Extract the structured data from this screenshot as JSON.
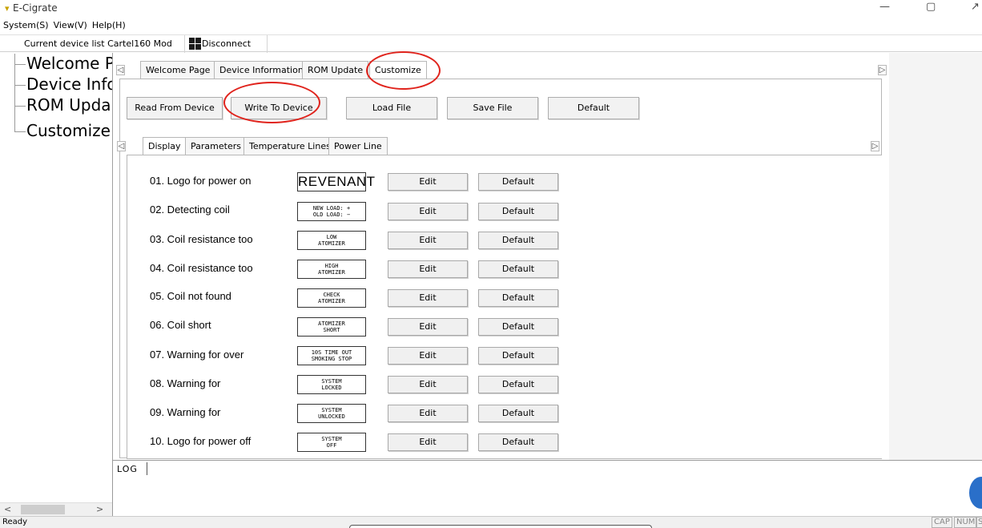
{
  "window": {
    "title": "E-Cigrate",
    "icon": "app-icon",
    "minimize": "—",
    "maximize": "▢",
    "restore": "↗"
  },
  "menu": {
    "items": [
      "System(S)",
      "View(V)",
      "Help(H)"
    ]
  },
  "device_bar": {
    "label": "Current device list",
    "device": "Cartel160 Mod",
    "disconnect_label": "Disconnect"
  },
  "tree": {
    "items": [
      "Welcome P",
      "Device Info",
      "ROM Upda",
      "Customize"
    ]
  },
  "top_tabs": [
    "Welcome Page",
    "Device Information",
    "ROM Update",
    "Customize"
  ],
  "actions": {
    "read": "Read From Device",
    "write": "Write To Device",
    "load": "Load File",
    "save": "Save File",
    "default": "Default"
  },
  "sub_tabs": [
    "Display",
    "Parameters",
    "Temperature Lines",
    "Power Line"
  ],
  "rows": [
    {
      "label": "01. Logo for power on",
      "preview": "REVENANT",
      "edit": "Edit",
      "default": "Default"
    },
    {
      "label": "02. Detecting coil",
      "preview": "NEW LOAD: +\nOLD LOAD: −",
      "edit": "Edit",
      "default": "Default"
    },
    {
      "label": "03. Coil resistance too",
      "preview": "LOW\nATOMIZER",
      "edit": "Edit",
      "default": "Default"
    },
    {
      "label": "04. Coil resistance too",
      "preview": "HIGH\nATOMIZER",
      "edit": "Edit",
      "default": "Default"
    },
    {
      "label": "05. Coil not found",
      "preview": "CHECK\nATOMIZER",
      "edit": "Edit",
      "default": "Default"
    },
    {
      "label": "06. Coil short",
      "preview": "ATOMIZER\nSHORT",
      "edit": "Edit",
      "default": "Default"
    },
    {
      "label": "07. Warning for over",
      "preview": "10S TIME OUT\nSMOKING STOP",
      "edit": "Edit",
      "default": "Default"
    },
    {
      "label": "08. Warning for",
      "preview": "SYSTEM\nLOCKED",
      "edit": "Edit",
      "default": "Default"
    },
    {
      "label": "09. Warning for",
      "preview": "SYSTEM\nUNLOCKED",
      "edit": "Edit",
      "default": "Default"
    },
    {
      "label": "10. Logo for power off",
      "preview": "SYSTEM\nOFF",
      "edit": "Edit",
      "default": "Default"
    }
  ],
  "log": {
    "label": "LOG"
  },
  "status": {
    "text": "Ready",
    "indicators": [
      "CAP",
      "NUM",
      "S"
    ]
  },
  "colors": {
    "annotation_circle": "#e0231c",
    "accent_blob": "#2a6fc9"
  }
}
